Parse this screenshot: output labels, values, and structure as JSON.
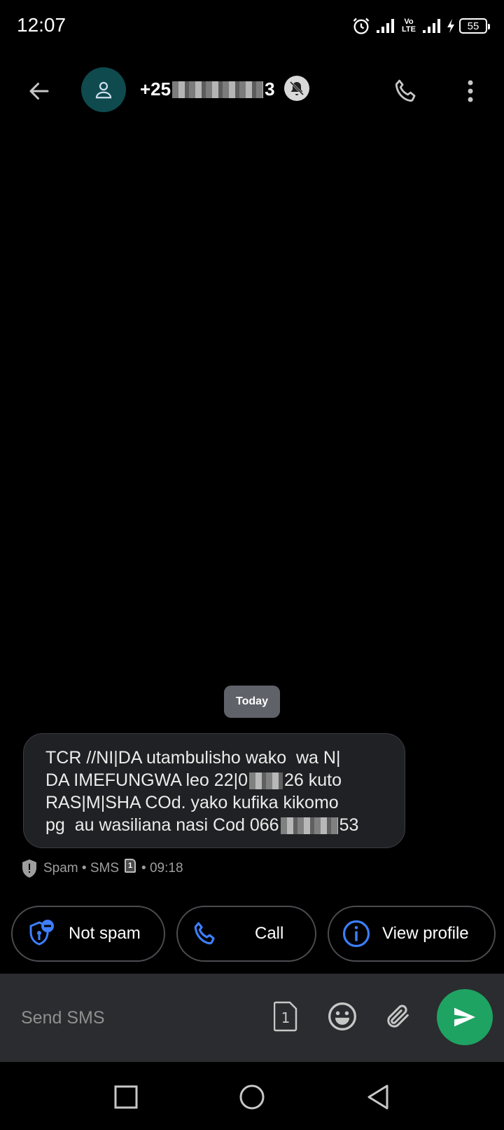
{
  "status_bar": {
    "time": "12:07",
    "volte_top": "Vo",
    "volte_bottom": "LTE",
    "battery": "55"
  },
  "header": {
    "contact_prefix": "+25",
    "contact_suffix": "3",
    "icons": [
      "arrow-back-icon",
      "person-icon",
      "notifications-off-icon",
      "phone-icon",
      "more-vert-icon"
    ]
  },
  "conversation": {
    "date_chip": "Today",
    "message": {
      "line1": "TCR //NI|DA utambulisho wako  wa N|",
      "line2_a": "DA IMEFUNGWA leo 22|0",
      "line2_b": "26 kuto",
      "line3": "RAS|M|SHA COd. yako kufika kikomo",
      "line4_a": "pg  au wasiliana nasi Cod 066",
      "line4_b": "53"
    },
    "meta": {
      "label": "Spam • SMS",
      "sim": "1",
      "time": "• 09:18"
    }
  },
  "suggestions": {
    "not_spam": "Not spam",
    "call": "Call",
    "view_profile": "View profile"
  },
  "compose": {
    "placeholder": "Send SMS",
    "sim": "1"
  },
  "colors": {
    "accent_blue": "#3d7fff",
    "send_green": "#1ea362",
    "avatar_bg": "#0e4a4e",
    "compose_bg": "#2b2c2f"
  }
}
